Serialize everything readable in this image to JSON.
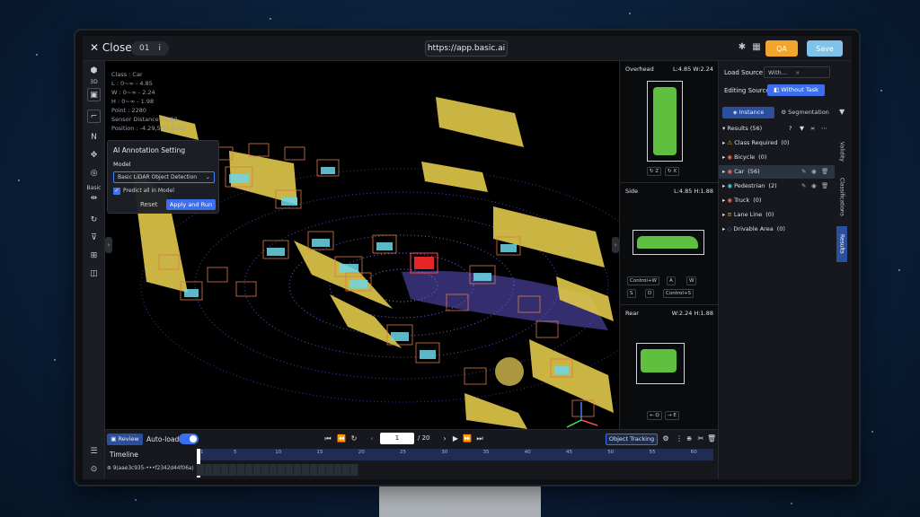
{
  "topbar": {
    "close_label": "Close",
    "frame_chip": "01",
    "frame_info_icon": "i",
    "url": "https://app.basic.ai",
    "qa_label": "QA",
    "save_label": "Save"
  },
  "left_toolbar": {
    "label_3d": "3D",
    "label_basic": "Basic"
  },
  "viewport_info": {
    "class_line": "Class : Car",
    "l_line": "L : 0~∞ - 4.85",
    "w_line": "W : 0~∞ - 2.24",
    "h_line": "H : 0~∞ - 1.98",
    "point_line": "Point : 2280",
    "sensor_line": "Sensor Distance : 7.62",
    "position_line": "Position : -4.29,5.51,0.72"
  },
  "ai_panel": {
    "title": "AI Annotation Setting",
    "model_label": "Model",
    "model_value": "Basic LiDAR Object Detection",
    "predict_label": "Predict all in Model",
    "reset_label": "Reset",
    "apply_label": "Apply and Run"
  },
  "views": {
    "overhead": {
      "title": "Overhead",
      "dims": "L:4.85 W:2.24",
      "btn1": "Z",
      "btn2": "X"
    },
    "side": {
      "title": "Side",
      "dims": "L:4.85 H:1.88",
      "btns": [
        "Control+W",
        "A",
        "W",
        "S",
        "D",
        "Control+S"
      ]
    },
    "rear": {
      "title": "Rear",
      "dims": "W:2.24 H:1.88",
      "btn1": "Q",
      "btn2": "E"
    }
  },
  "right_panel": {
    "load_source_label": "Load Source",
    "load_source_value": "With...",
    "editing_source_label": "Editing Source",
    "editing_source_value": "Without Task",
    "tab_instance": "Instance",
    "tab_segmentation": "Segmentation",
    "results_label": "Results (56)",
    "tree": [
      {
        "label": "Class Required",
        "count": "(0)",
        "color": "#f2a42b"
      },
      {
        "label": "Bicycle",
        "count": "(0)",
        "color": "#e0734a"
      },
      {
        "label": "Car",
        "count": "(56)",
        "color": "#e0734a"
      },
      {
        "label": "Pedestrian",
        "count": "(2)",
        "color": "#4ccbd6"
      },
      {
        "label": "Truck",
        "count": "(0)",
        "color": "#e0734a"
      },
      {
        "label": "Lane Line",
        "count": "(0)",
        "color": "#f2c12b"
      },
      {
        "label": "Drivable Area",
        "count": "(0)",
        "color": "#4a7df0"
      }
    ],
    "vtab_validity": "Validity",
    "vtab_classifications": "Classifications",
    "vtab_results": "Results"
  },
  "bottom": {
    "review_label": "Review",
    "autoload_label": "Auto-load",
    "frame_current": "1",
    "frame_total": "/ 20",
    "object_tracking_label": "Object Tracking",
    "timeline_label": "Timeline",
    "ticks": [
      "1",
      "5",
      "10",
      "15",
      "20",
      "25",
      "30",
      "35",
      "40",
      "45",
      "50",
      "55",
      "60"
    ],
    "track_id": "9(aae3c935-•••f2342d44f06a)"
  },
  "colors": {
    "accent_blue": "#3b6ff0",
    "qa_orange": "#f2a42b",
    "save_light_blue": "#7fc3ea",
    "car_box": "#d9784a",
    "selected_box": "#ff2a2a",
    "pointcloud_yellow": "#e8d24a",
    "pointcloud_cyan": "#6fd7e8",
    "pointcloud_purple": "#7a6ee8",
    "pointcloud_green": "#6fe04a"
  }
}
